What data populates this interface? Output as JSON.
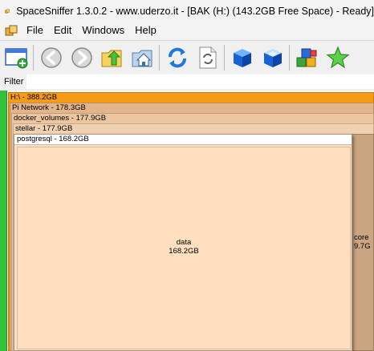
{
  "window": {
    "title": "SpaceSniffer 1.3.0.2 - www.uderzo.it - [BAK (H:) (143.2GB Free Space) - Ready]"
  },
  "menu": {
    "items": [
      "File",
      "Edit",
      "Windows",
      "Help"
    ]
  },
  "toolbar": {
    "buttons": [
      "new-view-icon",
      "back-icon",
      "forward-icon",
      "parent-folder-icon",
      "home-icon",
      "refresh-icon",
      "rescan-document-icon",
      "blue-box-icon",
      "blue-box-open-icon",
      "cubes-icon",
      "star-icon"
    ]
  },
  "filter": {
    "label": "Filter",
    "value": ""
  },
  "treemap": {
    "root": {
      "label": "H:\\ - 388.2GB"
    },
    "pi_network": {
      "label": "Pi Network - 178.3GB"
    },
    "docker_volumes": {
      "label": "docker_volumes - 177.9GB"
    },
    "stellar": {
      "label": "stellar - 177.9GB"
    },
    "postgresql": {
      "label": "postgresql - 168.2GB"
    },
    "data": {
      "name": "data",
      "size": "168.2GB"
    },
    "core": {
      "name": "core",
      "size": "9.7G"
    }
  },
  "colors": {
    "root": "#f59b16",
    "green_strip": "#2fc23a",
    "data_block": "#ffdfbf"
  }
}
